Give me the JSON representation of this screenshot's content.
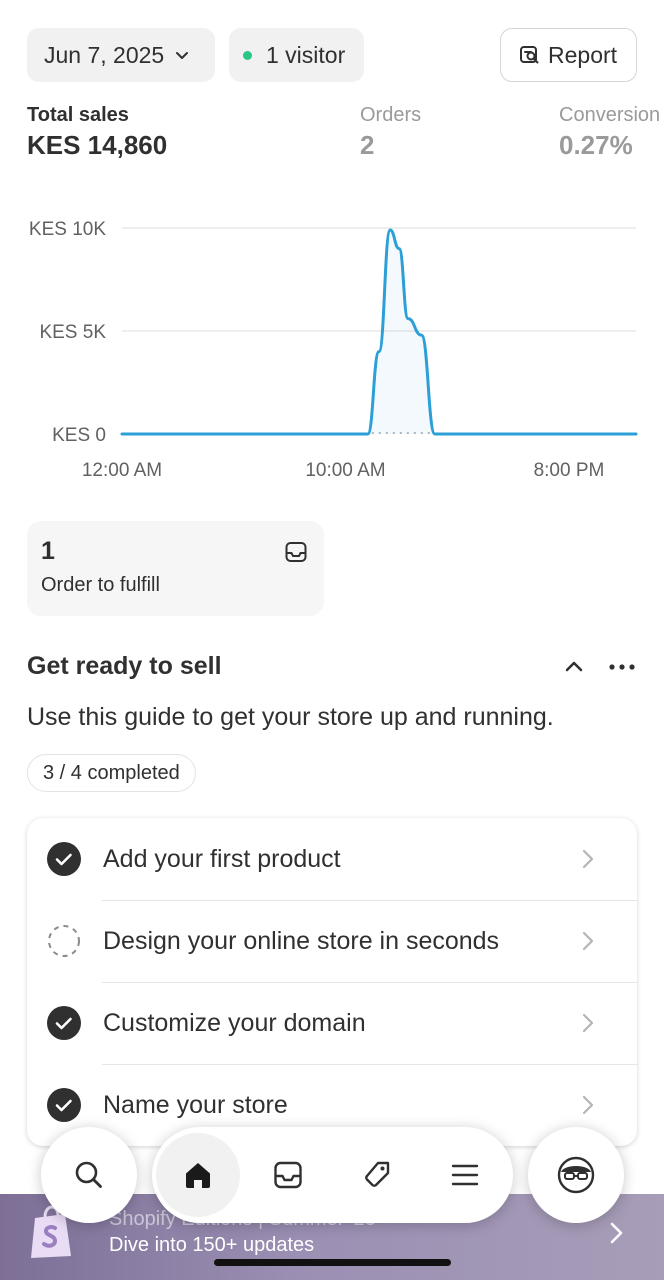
{
  "header": {
    "date_label": "Jun 7, 2025",
    "visitors_label": "1 visitor",
    "report_label": "Report"
  },
  "metrics": [
    {
      "label": "Total sales",
      "value": "KES 14,860"
    },
    {
      "label": "Orders",
      "value": "2"
    },
    {
      "label": "Conversion",
      "value": "0.27%"
    }
  ],
  "chart_data": {
    "type": "line",
    "title": "",
    "xlabel": "",
    "ylabel": "",
    "y_ticks": [
      "KES 0",
      "KES 5K",
      "KES 10K"
    ],
    "x_ticks": [
      "12:00 AM",
      "10:00 AM",
      "8:00 PM"
    ],
    "ylim": [
      0,
      10000
    ],
    "xlim": [
      0,
      23
    ],
    "grid": true,
    "series": [
      {
        "x": [
          0,
          11,
          11.5,
          12,
          12.4,
          12.8,
          13.4,
          14,
          23
        ],
        "values": [
          0,
          0,
          4000,
          9900,
          9000,
          5600,
          4800,
          0,
          0
        ]
      }
    ],
    "colors": {
      "line": "#2b9fd6",
      "grid": "#e3e3e3"
    }
  },
  "fulfill": {
    "count": "1",
    "label": "Order to fulfill"
  },
  "setup": {
    "title": "Get ready to sell",
    "description": "Use this guide to get your store up and running.",
    "progress": "3 / 4 completed",
    "tasks": [
      {
        "label": "Add your first product",
        "done": true
      },
      {
        "label": "Design your online store in seconds",
        "done": false
      },
      {
        "label": "Customize your domain",
        "done": true
      },
      {
        "label": "Name your store",
        "done": true
      }
    ]
  },
  "promo": {
    "title": "Shopify Editions | Summer '25",
    "subtitle": "Dive into 150+ updates"
  },
  "nav": {
    "items": [
      "search-icon",
      "home-icon",
      "orders-icon",
      "products-icon",
      "menu-icon",
      "profile-icon"
    ]
  }
}
